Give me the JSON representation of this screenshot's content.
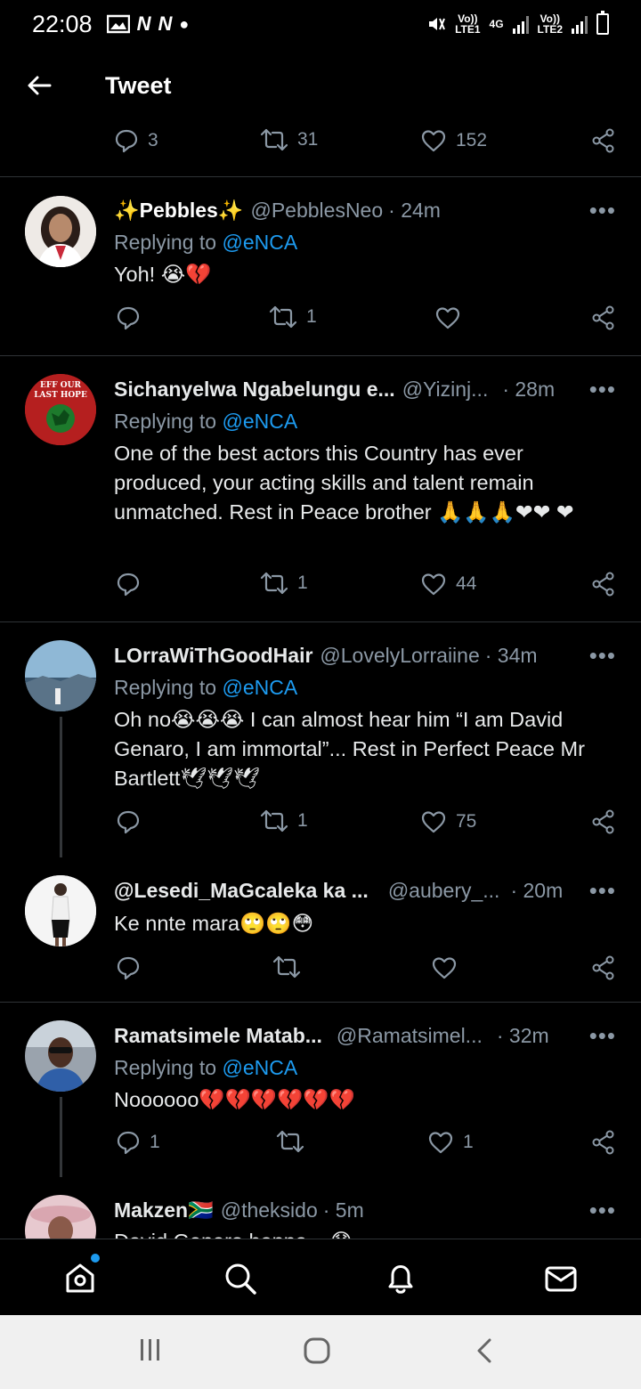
{
  "status_bar": {
    "time": "22:08",
    "notifications": [
      "N",
      "N"
    ],
    "sim1": "Vo))\nLTE1",
    "network": "4G",
    "sim2": "Vo))\nLTE2"
  },
  "header": {
    "title": "Tweet"
  },
  "main_tweet_actions": {
    "replies": "3",
    "retweets": "31",
    "likes": "152"
  },
  "replies": [
    {
      "name": "✨Pebbles✨",
      "handle": "@PebblesNeo",
      "time": "· 24m",
      "replying_label": "Replying to",
      "replying_to": "@eNCA",
      "text": "Yoh! 😭💔",
      "actions": {
        "replies": "",
        "retweets": "1",
        "likes": ""
      }
    },
    {
      "name": "Sichanyelwa Ngabelungu e...",
      "handle": "@Yizinj...",
      "time": "· 28m",
      "replying_label": "Replying to",
      "replying_to": "@eNCA",
      "text": "One of the best actors this Country has ever produced, your acting skills and talent remain unmatched. Rest in Peace brother 🙏🙏🙏❤❤ ❤",
      "avatar_text": "EFF OUR LAST HOPE",
      "actions": {
        "replies": "",
        "retweets": "1",
        "likes": "44"
      }
    },
    {
      "name": "LOrraWiThGoodHair",
      "handle": "@LovelyLorraiine",
      "time": "· 34m",
      "replying_label": "Replying to",
      "replying_to": "@eNCA",
      "text": "Oh no😭😭😭 I can almost hear him “I am David Genaro, I am immortal”... Rest in Perfect Peace Mr Bartlett🕊🕊🕊",
      "actions": {
        "replies": "",
        "retweets": "1",
        "likes": "75"
      }
    },
    {
      "name": "@Lesedi_MaGcaleka ka ...",
      "handle": "@aubery_...",
      "time": "· 20m",
      "text": "Ke nnte mara🙄🙄😳",
      "actions": {
        "replies": "",
        "retweets": "",
        "likes": ""
      }
    },
    {
      "name": "Ramatsimele Matab...",
      "handle": "@Ramatsimel...",
      "time": "· 32m",
      "replying_label": "Replying to",
      "replying_to": "@eNCA",
      "text": "Noooooo💔💔💔💔💔💔",
      "actions": {
        "replies": "1",
        "retweets": "",
        "likes": "1"
      }
    },
    {
      "name": "Makzen🇿🇦",
      "handle": "@theksido",
      "time": "· 5m",
      "text": "David Genaro hanna... 😯"
    }
  ],
  "more_label": "•••",
  "colors": {
    "accent": "#1d9bf0",
    "muted": "#8b98a5",
    "background": "#000000",
    "divider": "#2f3336"
  },
  "icons": {
    "bottom_nav": [
      "home-icon",
      "search-icon",
      "notifications-icon",
      "messages-icon"
    ],
    "system_nav": [
      "recents-icon",
      "home-button-icon",
      "back-button-icon"
    ]
  }
}
